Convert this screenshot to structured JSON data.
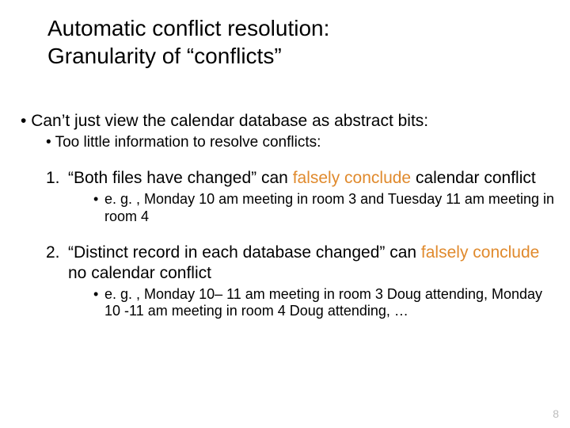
{
  "title_l1": "Automatic conflict resolution:",
  "title_l2": "Granularity of “conflicts”",
  "b1": "Can’t just view the calendar database as abstract bits:",
  "b1a": "Too little information to resolve conflicts:",
  "n1_a": "“Both files have changed” can ",
  "n1_h": "falsely conclude",
  "n1_b": " calendar conflict",
  "n1_eg": "e. g. , Monday 10 am meeting in room 3 and Tuesday 11 am meeting in room 4",
  "n2_a": "“Distinct record in each database changed” can ",
  "n2_h": "falsely conclude",
  "n2_b": " no calendar conflict",
  "n2_eg": "e. g. , Monday 10– 11 am meeting in room 3 Doug attending, Monday 10 -11 am meeting in room 4 Doug attending, …",
  "page": "8"
}
